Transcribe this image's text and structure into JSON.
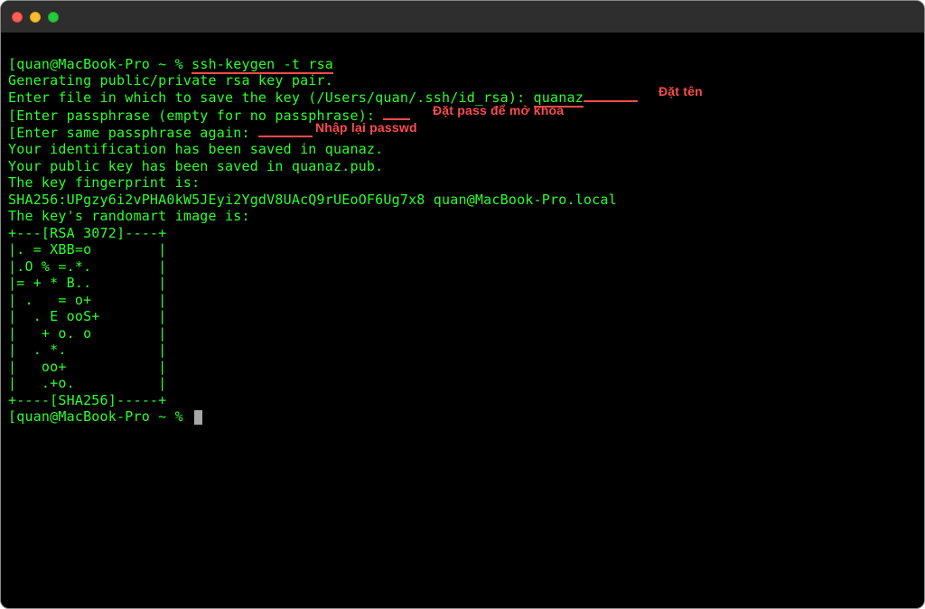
{
  "prompt": {
    "user_host": "quan@MacBook-Pro",
    "path": "~",
    "symbol": "%"
  },
  "command": "ssh-keygen -t rsa",
  "output": {
    "generating": "Generating public/private rsa key pair.",
    "enter_file_pre": "Enter file in which to save the key (/Users/quan/.ssh/id_rsa): ",
    "enter_file_val": "quanaz",
    "enter_pass": "Enter passphrase (empty for no passphrase): ",
    "enter_same": "Enter same passphrase again: ",
    "ident_saved": "Your identification has been saved in quanaz.",
    "pub_saved": "Your public key has been saved in quanaz.pub.",
    "fp_label": "The key fingerprint is:",
    "fp_value": "SHA256:UPgzy6i2vPHA0kW5JEyi2YgdV8UAcQ9rUEoOF6Ug7x8 quan@MacBook-Pro.local",
    "randomart_label": "The key's randomart image is:",
    "randomart": [
      "+---[RSA 3072]----+",
      "|. = XBB=o        |",
      "|.O % =.*.        |",
      "|= + * B..        |",
      "| .   = o+        |",
      "|  . E ooS+       |",
      "|   + o. o        |",
      "|  . *.           |",
      "|   oo+           |",
      "|   .+o.          |",
      "+----[SHA256]-----+"
    ]
  },
  "annotations": {
    "name": "Đặt tên",
    "pass": "Đặt pass để mở khóa",
    "repeat": "Nhập lại passwd"
  }
}
